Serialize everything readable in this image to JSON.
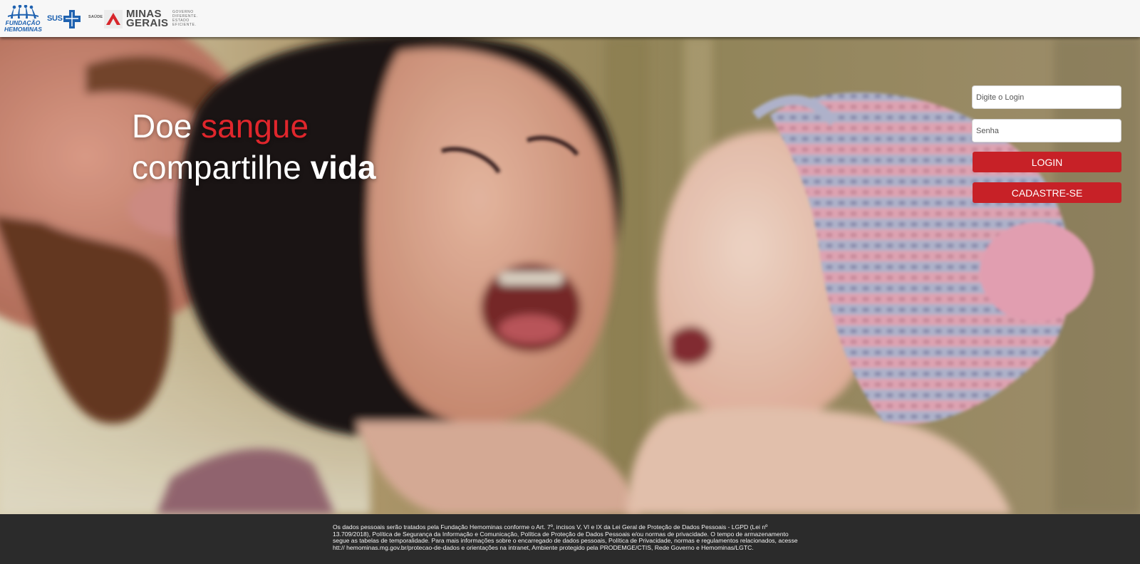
{
  "header": {
    "logo_hemominas": {
      "line1": "FUNDAÇÃO",
      "line2": "HEMOMINAS",
      "color": "#1f62b0"
    },
    "logo_sus": {
      "text": "SUS",
      "color": "#1f62b0"
    },
    "label_saude": "SAÚDE",
    "logo_mg": {
      "line1": "MINAS",
      "line2": "GERAIS",
      "tagline": [
        "GOVERNO",
        "DIFERENTE.",
        "ESTADO",
        "EFICIENTE."
      ],
      "accent": "#d7262b"
    }
  },
  "hero": {
    "headline": {
      "word1": "Doe",
      "word2": "sangue",
      "word3": "compartilhe",
      "word4": "vida"
    },
    "accent": "#e0262c"
  },
  "login": {
    "login_placeholder": "Digite o Login",
    "senha_placeholder": "Senha",
    "login_button": "LOGIN",
    "register_button": "CADASTRE-SE",
    "button_color": "#c72127"
  },
  "footer": {
    "text": "Os dados pessoais serão tratados pela Fundação Hemominas conforme o Art. 7º, incisos V, VI e IX da Lei Geral de Proteção de Dados Pessoais - LGPD (Lei nº 13.709/2018), Política de Segurança da Informação e Comunicação, Política de Proteção de Dados Pessoais e/ou normas de privacidade. O tempo de armazenamento segue as tabelas de temporalidade. Para mais informações sobre o encarregado de dados pessoais, Política de Privacidade, normas e regulamentos relacionados, acesse htt:// hemominas.mg.gov.br/protecao-de-dados e orientações na intranet, Ambiente protegido pela PRODEMGE/CTIS, Rede Governo e Hemominas/LGTC."
  }
}
